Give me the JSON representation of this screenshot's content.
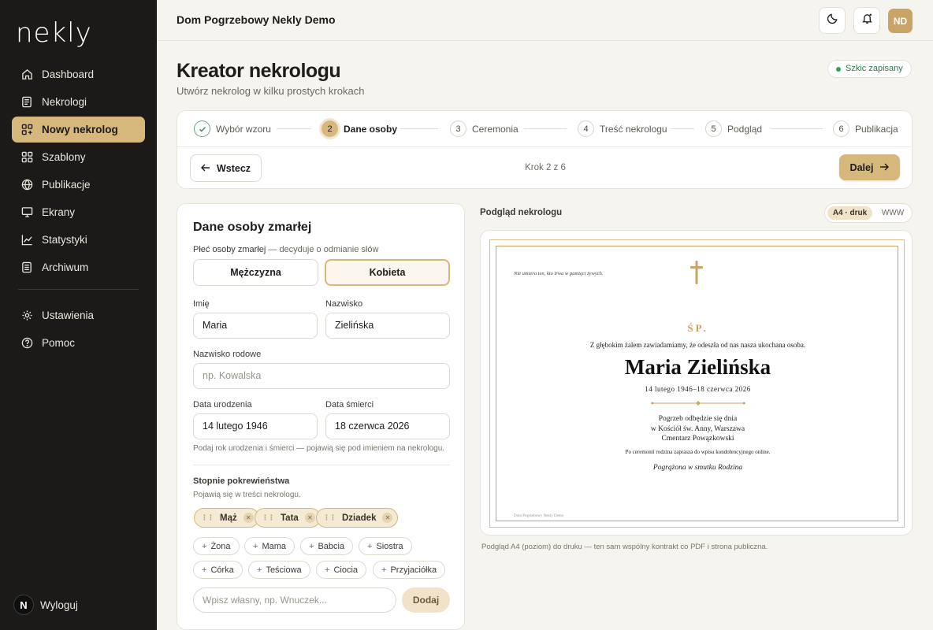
{
  "sidebar": {
    "logo": "nekly",
    "items": [
      {
        "label": "Dashboard",
        "icon": "home-icon"
      },
      {
        "label": "Nekrologi",
        "icon": "document-icon"
      },
      {
        "label": "Nowy nekrolog",
        "icon": "add-grid-icon",
        "active": true
      },
      {
        "label": "Szablony",
        "icon": "grid-icon"
      },
      {
        "label": "Publikacje",
        "icon": "globe-icon"
      },
      {
        "label": "Ekrany",
        "icon": "monitor-icon"
      },
      {
        "label": "Statystyki",
        "icon": "chart-line-icon"
      },
      {
        "label": "Archiwum",
        "icon": "archive-icon"
      }
    ],
    "bottom_items": [
      {
        "label": "Ustawienia",
        "icon": "gear-icon"
      },
      {
        "label": "Pomoc",
        "icon": "help-icon"
      }
    ],
    "logout": {
      "badge": "N",
      "label": "Wyloguj"
    }
  },
  "topbar": {
    "org_name": "Dom Pogrzebowy Nekly Demo",
    "avatar": "ND"
  },
  "header": {
    "title": "Kreator nekrologu",
    "subtitle": "Utwórz nekrolog w kilku prostych krokach",
    "saved_badge": "Szkic zapisany"
  },
  "stepper": {
    "steps": [
      {
        "num": "1",
        "label": "Wybór wzoru",
        "state": "done"
      },
      {
        "num": "2",
        "label": "Dane osoby",
        "state": "current"
      },
      {
        "num": "3",
        "label": "Ceremonia",
        "state": "todo"
      },
      {
        "num": "4",
        "label": "Treść nekrologu",
        "state": "todo"
      },
      {
        "num": "5",
        "label": "Podgląd",
        "state": "todo"
      },
      {
        "num": "6",
        "label": "Publikacja",
        "state": "todo"
      }
    ],
    "back_label": "Wstecz",
    "step_count": "Krok 2 z 6",
    "next_label": "Dalej"
  },
  "form": {
    "title": "Dane osoby zmarłej",
    "gender_label": "Płeć osoby zmarłej",
    "gender_hint": " — decyduje o odmianie słów",
    "gender_options": [
      "Mężczyzna",
      "Kobieta"
    ],
    "gender_selected": "Kobieta",
    "first_name_label": "Imię",
    "first_name_value": "Maria",
    "last_name_label": "Nazwisko",
    "last_name_value": "Zielińska",
    "maiden_name_label": "Nazwisko rodowe",
    "maiden_name_placeholder": "np. Kowalska",
    "birth_label": "Data urodzenia",
    "birth_value": "14 lutego 1946",
    "death_label": "Data śmierci",
    "death_value": "18 czerwca 2026",
    "dates_hint": "Podaj rok urodzenia i śmierci — pojawią się pod imieniem na nekrologu.",
    "kinship_title": "Stopnie pokrewieństwa",
    "kinship_hint": "Pojawią się w treści nekrologu.",
    "selected_kinship": [
      "Mąż",
      "Tata",
      "Dziadek"
    ],
    "suggested_kinship_row1": [
      "Żona",
      "Mama",
      "Babcia",
      "Siostra"
    ],
    "suggested_kinship_row2": [
      "Córka",
      "Teściowa",
      "Ciocia",
      "Przyjaciółka"
    ],
    "custom_placeholder": "Wpisz własny, np. Wnuczek...",
    "add_label": "Dodaj"
  },
  "preview": {
    "label": "Podgląd nekrologu",
    "toggle": [
      "A4 · druk",
      "WWW"
    ],
    "toggle_selected": "A4 · druk",
    "caption": "Podgląd A4 (poziom) do druku — ten sam wspólny kontrakt co PDF i strona publiczna.",
    "obituary": {
      "quote": "Nie umiera ten, kto trwa w pamięci żywych.",
      "sp": "ŚP.",
      "intro": "Z głębokim żalem zawiadamiamy, że odeszła od nas nasza ukochana osoba.",
      "name": "Maria Zielińska",
      "dates": "14 lutego 1946–18 czerwca 2026",
      "ceremony_1": "Pogrzeb odbędzie się dnia",
      "ceremony_2": "w Kościół św. Anny, Warszawa",
      "ceremony_3": "Cmentarz Powązkowski",
      "after": "Po ceremonii rodzina zaprasza do wpisu kondolencyjnego online.",
      "signature": "Pogrążona w smutku Rodzina",
      "footer": "Dom Pogrzebowy Nekly Demo"
    }
  },
  "colors": {
    "accent": "#d6b77c",
    "sidebar_bg": "#1b1a18",
    "gold": "#c9a466",
    "success": "#2fa05a"
  }
}
